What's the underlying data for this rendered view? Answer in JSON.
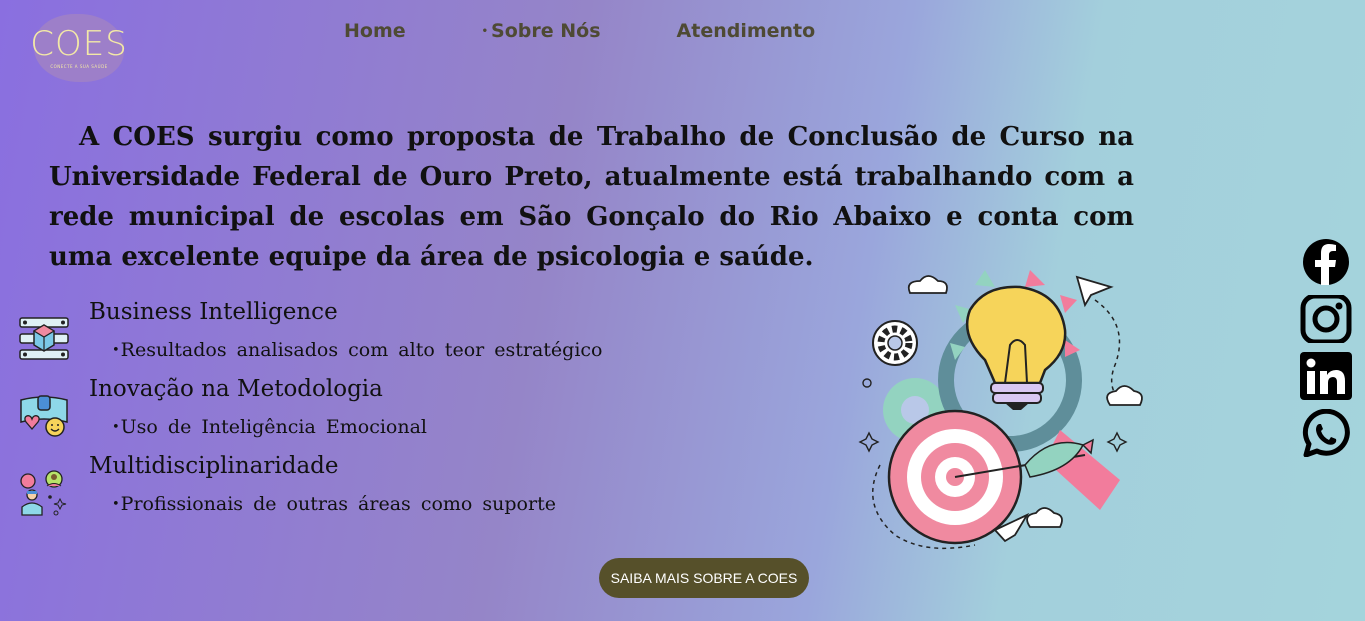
{
  "logo": {
    "mark": "COES",
    "tagline": "CONECTE A SUA SAÚDE"
  },
  "nav": {
    "home": "Home",
    "about": "Sobre Nós",
    "about_bullet": "•",
    "contact": "Atendimento"
  },
  "intro": "A COES surgiu como proposta de Trabalho de Conclusão de Curso na Universidade Federal de Ouro Preto, atualmente está trabalhando com a rede municipal de escolas em São Gonçalo do Rio Abaixo e conta com uma excelente equipe da área de psicologia e saúde.",
  "features": [
    {
      "icon": "server-cube-icon",
      "title": "Business Intelligence",
      "bullet": "•",
      "detail": "Resultados analisados com alto teor estratégico"
    },
    {
      "icon": "feedback-emoji-icon",
      "title": "Inovação na Metodologia",
      "bullet": "•",
      "detail": "Uso de Inteligência Emocional"
    },
    {
      "icon": "team-chat-icon",
      "title": "Multidisciplinaridade",
      "bullet": "•",
      "detail": "Profissionais de outras áreas como suporte"
    }
  ],
  "social": [
    "facebook-icon",
    "instagram-icon",
    "linkedin-icon",
    "whatsapp-icon"
  ],
  "cta": "SAIBA MAIS SOBRE A COES",
  "colors": {
    "cta_bg": "#56502a",
    "nav_text": "#4e4a34",
    "logo_bg": "#9d7fc9",
    "logo_text": "#f3e9a6"
  }
}
